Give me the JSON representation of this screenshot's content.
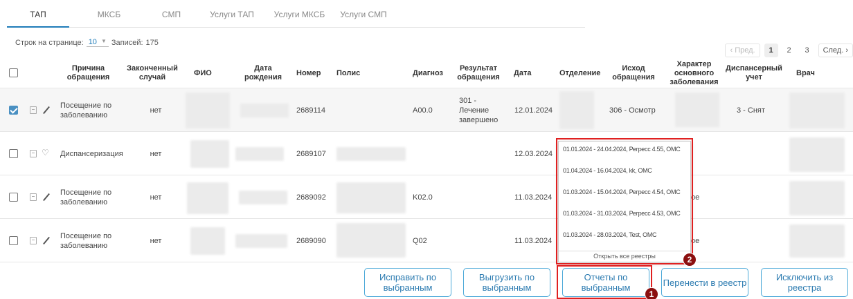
{
  "tabs": [
    {
      "label": "ТАП",
      "active": true
    },
    {
      "label": "МКСБ",
      "active": false
    },
    {
      "label": "СМП",
      "active": false
    },
    {
      "label": "Услуги ТАП",
      "active": false
    },
    {
      "label": "Услуги МКСБ",
      "active": false
    },
    {
      "label": "Услуги СМП",
      "active": false
    }
  ],
  "pager": {
    "rows_label": "Строк на странице:",
    "rows_value": "10",
    "records_label": "Записей:",
    "records_value": "175",
    "prev": "‹ Пред.",
    "pages": [
      "1",
      "2",
      "3"
    ],
    "next": "След. ›"
  },
  "columns": {
    "reason": "Причина обращения",
    "finished": "Законченный случай",
    "fio": "ФИО",
    "birth": "Дата рождения",
    "number": "Номер",
    "policy": "Полис",
    "diagnosis": "Диагноз",
    "result": "Результат обращения",
    "date": "Дата",
    "department": "Отделение",
    "outcome": "Исход обращения",
    "character": "Характер основного заболевания",
    "dispensary": "Диспансерный учет",
    "doctor": "Врач"
  },
  "rows": [
    {
      "checked": true,
      "reason": "Посещение по заболеванию",
      "finished": "нет",
      "number": "2689114",
      "diagnosis": "A00.0",
      "result": "301 - Лечение завершено",
      "date": "12.01.2024",
      "outcome": "306 - Осмотр",
      "dispensary": "3 - Снят"
    },
    {
      "checked": false,
      "reason": "Диспансеризация",
      "finished": "нет",
      "number": "2689107",
      "diagnosis": "",
      "result": "",
      "date": "12.03.2024",
      "outcome": "",
      "dispensary": ""
    },
    {
      "checked": false,
      "reason": "Посещение по заболеванию",
      "finished": "нет",
      "number": "2689092",
      "diagnosis": "K02.0",
      "result": "",
      "date": "11.03.2024",
      "outcome": "",
      "dispensary": ""
    },
    {
      "checked": false,
      "reason": "Посещение по заболеванию",
      "finished": "нет",
      "number": "2689090",
      "diagnosis": "Q02",
      "result": "",
      "date": "11.03.2024",
      "outcome": "",
      "dispensary": ""
    }
  ],
  "partial_text": {
    "row3": "ое",
    "row4": "ое"
  },
  "registry_popup": {
    "items": [
      "01.01.2024 - 24.04.2024, Регресс 4.55, ОМС",
      "01.04.2024 - 16.04.2024, kk, ОМС",
      "01.03.2024 - 15.04.2024, Регресс 4.54, ОМС",
      "01.03.2024 - 31.03.2024, Регресс 4.53, ОМС",
      "01.03.2024 - 28.03.2024, Test, ОМС"
    ],
    "open_all": "Открыть все реестры"
  },
  "badges": {
    "one": "1",
    "two": "2"
  },
  "buttons": {
    "fix": "Исправить по выбранным",
    "export": "Выгрузить по выбранным",
    "reports": "Отчеты по выбранным",
    "move": "Перенести в реестр",
    "exclude": "Исключить из реестра"
  },
  "colors": {
    "accent": "#1e7bb8",
    "highlight": "#e02020",
    "badge": "#8b0f0f",
    "button_border": "#4aa8d8"
  }
}
